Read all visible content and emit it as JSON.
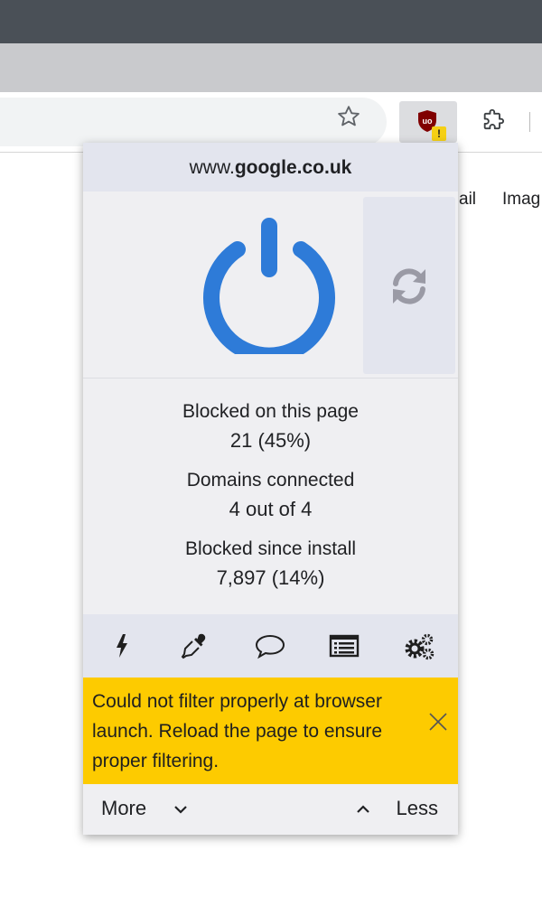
{
  "browser": {
    "extensions": [
      {
        "name": "uBlock Origin",
        "icon": "ublock-shield-icon",
        "badge": "!"
      },
      {
        "name": "Extensions",
        "icon": "puzzle-icon"
      }
    ]
  },
  "page_links": [
    "ail",
    "Imag"
  ],
  "popup": {
    "hostname_prefix": "www.",
    "hostname_domain": "google.co.uk",
    "power_icon": "power-icon",
    "refresh_icon": "refresh-icon",
    "stats": [
      {
        "label": "Blocked on this page",
        "value": "21 (45%)"
      },
      {
        "label": "Domains connected",
        "value": "4 out of 4"
      },
      {
        "label": "Blocked since install",
        "value": "7,897 (14%)"
      }
    ],
    "tools": [
      "lightning-icon",
      "eyedropper-icon",
      "speech-bubble-icon",
      "logger-list-icon",
      "gears-icon"
    ],
    "notice": "Could not filter properly at browser launch. Reload the page to ensure proper filtering.",
    "footer": {
      "more": "More",
      "less": "Less"
    }
  },
  "colors": {
    "power_blue": "#2e7bd8",
    "notice_yellow": "#fdcb00",
    "panel_bg": "#efeff2",
    "header_bg": "#e3e5ee"
  }
}
